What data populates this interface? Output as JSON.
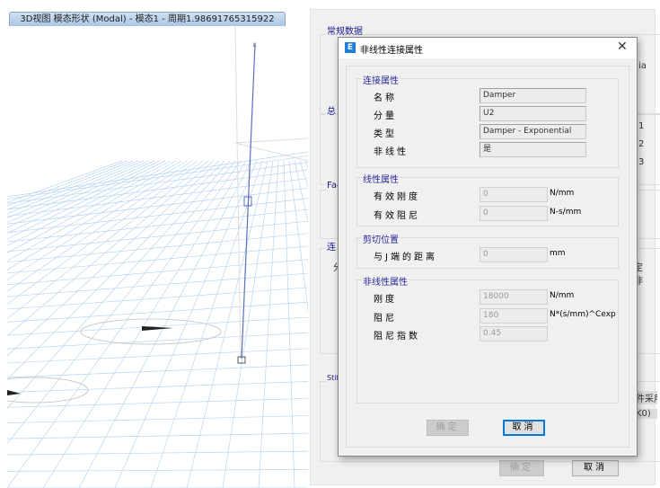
{
  "view_tab": {
    "title": "3D视图  模态形状 (Modal) - 模态1 - 周期1.98691765315922"
  },
  "background_panel": {
    "group_labels": [
      "常规数据",
      "总",
      "Fac",
      "连",
      "Stiff"
    ],
    "partial_texts": [
      "ia",
      "1",
      "2",
      "3",
      "分",
      "定  非",
      "件采用",
      "K0)"
    ],
    "ok_label": "确定",
    "cancel_label": "取消"
  },
  "dialog": {
    "title": "非线性连接属性",
    "icon": "E",
    "close_icon": "close-icon",
    "link_props": {
      "label": "连接属性",
      "rows": [
        {
          "label": "名称",
          "value": "Damper"
        },
        {
          "label": "分量",
          "value": "U2"
        },
        {
          "label": "类型",
          "value": "Damper - Exponential"
        },
        {
          "label": "非线性",
          "value": "是"
        }
      ]
    },
    "linear_props": {
      "label": "线性属性",
      "rows": [
        {
          "label": "有效刚度",
          "value": "0",
          "unit": "N/mm"
        },
        {
          "label": "有效阻尼",
          "value": "0",
          "unit": "N-s/mm"
        }
      ]
    },
    "shear": {
      "label": "剪切位置",
      "rows": [
        {
          "label": "与J端的距离",
          "value": "0",
          "unit": "mm"
        }
      ]
    },
    "nonlinear_props": {
      "label": "非线性属性",
      "rows": [
        {
          "label": "刚度",
          "value": "18000",
          "unit": "N/mm"
        },
        {
          "label": "阻尼",
          "value": "180",
          "unit": "N*(s/mm)^Cexp"
        },
        {
          "label": "阻尼指数",
          "value": "0.45"
        }
      ]
    },
    "ok_label": "确定",
    "cancel_label": "取消"
  }
}
